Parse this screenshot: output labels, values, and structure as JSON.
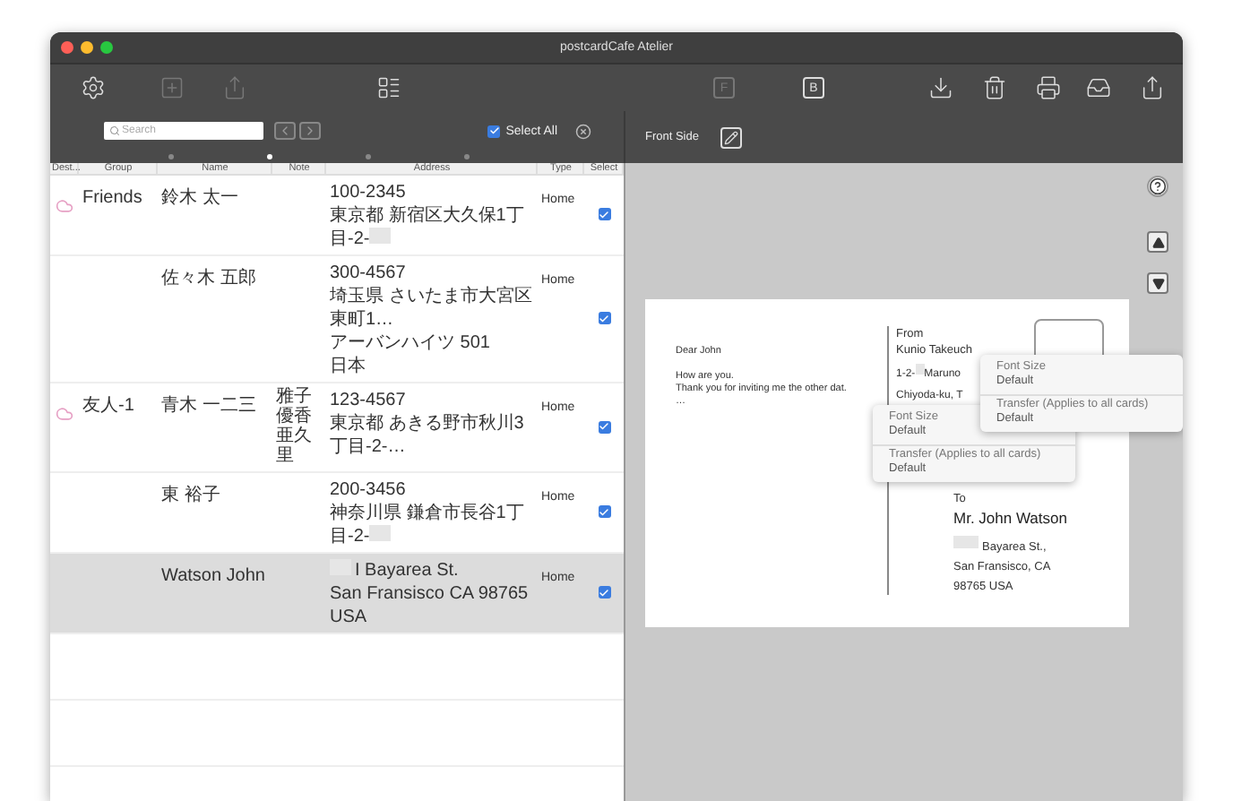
{
  "window": {
    "title": "postcardCafe Atelier"
  },
  "toolbar_left": [
    {
      "kind": "gear",
      "disabled": false
    },
    {
      "kind": "add",
      "disabled": true
    },
    {
      "kind": "export",
      "disabled": true
    },
    {
      "kind": "layout",
      "disabled": false
    }
  ],
  "toolbar_right": [
    {
      "kind": "letter",
      "label": "F",
      "disabled": true
    },
    {
      "kind": "letter",
      "label": "B",
      "disabled": false
    },
    {
      "kind": "import",
      "disabled": false
    },
    {
      "kind": "trash",
      "disabled": false
    },
    {
      "kind": "print",
      "disabled": false
    },
    {
      "kind": "tray",
      "disabled": false
    },
    {
      "kind": "share",
      "disabled": false
    }
  ],
  "list_bar": {
    "search": {
      "placeholder": "Search"
    },
    "select_all": {
      "label": "Select All",
      "checked": true
    },
    "page_dots": [
      {
        "selected": false
      },
      {
        "selected": true
      },
      {
        "selected": false
      },
      {
        "selected": false
      }
    ]
  },
  "preview_bar": {
    "label": "Front Side"
  },
  "table": {
    "columns": [
      "Dest...",
      "Group",
      "Name",
      "Note",
      "Address",
      "Type",
      "Select"
    ],
    "rows": [
      {
        "cloud": true,
        "group": "Friends",
        "name": "鈴木 太一",
        "note": [],
        "address": [
          {
            "text": "100-2345"
          },
          {
            "text": "東京都 新宿区大久保1丁目-2-",
            "mask_after": true
          }
        ],
        "type": "Home",
        "checked": true,
        "selected": false
      },
      {
        "cloud": false,
        "name": "佐々木 五郎",
        "note": [],
        "address": [
          {
            "text": "300-4567"
          },
          {
            "text": "埼玉県 さいたま市大宮区東町1…"
          },
          {
            "text": "アーバンハイツ 501"
          },
          {
            "text": "日本"
          }
        ],
        "type": "Home",
        "checked": true,
        "selected": false
      },
      {
        "cloud": true,
        "group": "友人-1",
        "name": "青木 一二三",
        "note": [
          "雅子",
          "優香",
          "亜久里"
        ],
        "address": [
          {
            "text": "123-4567"
          },
          {
            "text": "東京都 あきる野市秋川3丁目-2-…"
          }
        ],
        "type": "Home",
        "checked": true,
        "selected": false
      },
      {
        "cloud": false,
        "name": "東 裕子",
        "note": [],
        "address": [
          {
            "text": "200-3456"
          },
          {
            "text": "神奈川県 鎌倉市長谷1丁目-2-",
            "mask_after": true
          }
        ],
        "type": "Home",
        "checked": true,
        "selected": false
      },
      {
        "cloud": false,
        "name": "Watson John",
        "note": [],
        "address": [
          {
            "text": "I Bayarea St.",
            "mask_before": true
          },
          {
            "text": "San Fransisco CA 98765"
          },
          {
            "text": "USA"
          }
        ],
        "type": "Home",
        "checked": true,
        "selected": true
      }
    ]
  },
  "postcard": {
    "message": [
      "Dear John",
      "How are you.\nThank you for inviting me the other dat.\n…"
    ],
    "from": {
      "label": "From",
      "name": "Kunio Takeuch",
      "address": [
        {
          "text": "1-2-",
          "mask_after": true,
          "rest": "Maruno"
        },
        {
          "text": "Chiyoda-ku, T"
        }
      ]
    },
    "to": {
      "label": "To",
      "name": "Mr. John Watson",
      "address": [
        {
          "text": "Bayarea St.,",
          "mask_before": true
        },
        {
          "text": "San Fransisco, CA"
        },
        {
          "text": "98765 USA"
        }
      ]
    }
  },
  "popups": [
    {
      "items": [
        {
          "label": "Font Size",
          "value": "Default"
        },
        {
          "label": "Transfer (Applies to all cards)",
          "value": "Default"
        }
      ]
    },
    {
      "items": [
        {
          "label": "Font Size",
          "value": "Default"
        },
        {
          "label": "Transfer (Applies to all cards)",
          "value": "Default"
        }
      ]
    }
  ]
}
